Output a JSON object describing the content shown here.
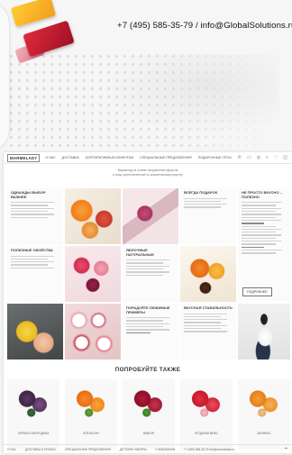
{
  "header": {
    "contact": "+7 (495) 585-35-79 / info@GlobalSolutions.ru"
  },
  "site": {
    "logo": "MARMELADY",
    "nav": [
      "О НАС",
      "ДОСТАВКА",
      "КОРПОРАТИВНЫМ КЛИЕНТАМ",
      "СПЕЦИАЛЬНЫЕ ПРЕДЛОЖЕНИЯ",
      "ПОДАРОЧНЫЕ СЕТЫ"
    ],
    "icons": [
      "phone-icon",
      "cart-icon",
      "user-icon",
      "search-icon",
      "heart-icon",
      "bag-icon"
    ],
    "icon_glyphs": [
      "✆",
      "▭",
      "◎",
      "⌕",
      "♡",
      "◫"
    ],
    "subtitle_line1": "Мармелад на основе натуральных фруктов",
    "subtitle_line2": "и ягод, приготовленный по классическому рецепту",
    "cells": {
      "choice_title": "ОДНАЖДЫ ВЫБОР ВАЖНЕЕ",
      "gift_title": "ВСЕГДА ПОДАРОК",
      "nofruit_title": "НЕ ПРОСТО ВКУСНО – ПОЛЕЗНО",
      "useful_title": "ПОЛЕЗНЫЕ СВОЙСТВА",
      "natural_title": "ЯБЛОЧНЫЕ НАТУРАЛЬНЫЕ",
      "fruit_title": "ПОРАДУЙТЕ ЛЮБИМЫЕ ПРИМЕРЫ",
      "quality_title": "ВКУСНАЯ СТАБИЛЬНОСТЬ",
      "more_button": "ПОДРОБНЕЕ"
    },
    "section_title": "ПОПРОБУЙТЕ ТАКЖЕ",
    "products": [
      "ЧЕРНАЯ СМОРОДИНА",
      "АПЕЛЬСИН",
      "ВИШНЯ",
      "ЯГОДНЫЙ МИКС",
      "АБРИКОС"
    ],
    "footer": [
      "О НАС",
      "ДОСТАВКА И ОПЛАТА",
      "СПЕЦИАЛЬНЫЕ ПРЕДЛОЖЕНИЯ",
      "ДЕТСКИЕ НАБОРЫ",
      "О КОМПАНИИ",
      "+7 (495) 585-35-79 info@marmelady.ru"
    ],
    "up_glyph": "⌃"
  }
}
